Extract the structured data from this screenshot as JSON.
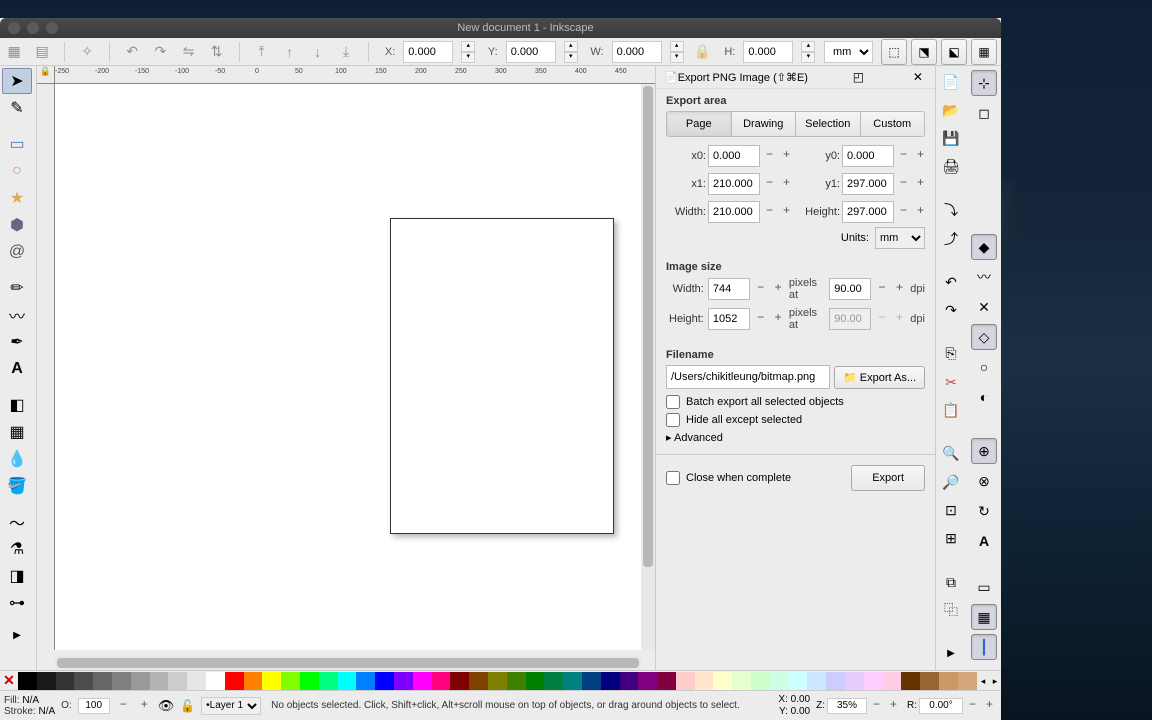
{
  "title": "New document 1 - Inkscape",
  "toolbar": {
    "x_label": "X:",
    "x_val": "0.000",
    "y_label": "Y:",
    "y_val": "0.000",
    "w_label": "W:",
    "w_val": "0.000",
    "h_label": "H:",
    "h_val": "0.000",
    "unit": "mm"
  },
  "ruler_marks": [
    "-250",
    "-200",
    "-150",
    "-100",
    "-50",
    "0",
    "50",
    "100",
    "150",
    "200",
    "250",
    "300",
    "350",
    "400",
    "450"
  ],
  "export": {
    "title": "Export PNG Image (⇧⌘E)",
    "area_label": "Export area",
    "tabs": [
      "Page",
      "Drawing",
      "Selection",
      "Custom"
    ],
    "x0_label": "x0:",
    "x0": "0.000",
    "y0_label": "y0:",
    "y0": "0.000",
    "x1_label": "x1:",
    "x1": "210.000",
    "y1_label": "y1:",
    "y1": "297.000",
    "width_label": "Width:",
    "width": "210.000",
    "height_label": "Height:",
    "height": "297.000",
    "units_label": "Units:",
    "units": "mm",
    "imgsize_label": "Image size",
    "img_w_label": "Width:",
    "img_w": "744",
    "img_h_label": "Height:",
    "img_h": "1052",
    "pixels_at": "pixels at",
    "dpi1": "90.00",
    "dpi2": "90.00",
    "dpi_label": "dpi",
    "filename_label": "Filename",
    "filename": "/Users/chikitleung/bitmap.png",
    "export_as": "Export As...",
    "batch": "Batch export all selected objects",
    "hide": "Hide all except selected",
    "advanced": "Advanced",
    "close_complete": "Close when complete",
    "export_btn": "Export"
  },
  "palette": [
    "#000000",
    "#1a1a1a",
    "#333333",
    "#4d4d4d",
    "#666666",
    "#808080",
    "#999999",
    "#b3b3b3",
    "#cccccc",
    "#e6e6e6",
    "#ffffff",
    "#ff0000",
    "#ff8000",
    "#ffff00",
    "#80ff00",
    "#00ff00",
    "#00ff80",
    "#00ffff",
    "#0080ff",
    "#0000ff",
    "#8000ff",
    "#ff00ff",
    "#ff0080",
    "#800000",
    "#804000",
    "#808000",
    "#408000",
    "#008000",
    "#008040",
    "#008080",
    "#004080",
    "#000080",
    "#400080",
    "#800080",
    "#800040",
    "#ffcccc",
    "#ffe6cc",
    "#ffffcc",
    "#e6ffcc",
    "#ccffcc",
    "#ccffe6",
    "#ccffff",
    "#cce6ff",
    "#ccccff",
    "#e6ccff",
    "#ffccff",
    "#ffcce6",
    "#663300",
    "#996633",
    "#cc9966",
    "#d2a679"
  ],
  "status": {
    "fill_label": "Fill:",
    "fill_val": "N/A",
    "stroke_label": "Stroke:",
    "stroke_val": "N/A",
    "o_label": "O:",
    "o_val": "100",
    "layer": "Layer 1",
    "msg": "No objects selected. Click, Shift+click, Alt+scroll mouse on top of objects, or drag around objects to select.",
    "x_label": "X:",
    "x_val": "0.00",
    "y_label": "Y:",
    "y_val": "0.00",
    "z_label": "Z:",
    "z_val": "35%",
    "r_label": "R:",
    "r_val": "0.00°"
  }
}
